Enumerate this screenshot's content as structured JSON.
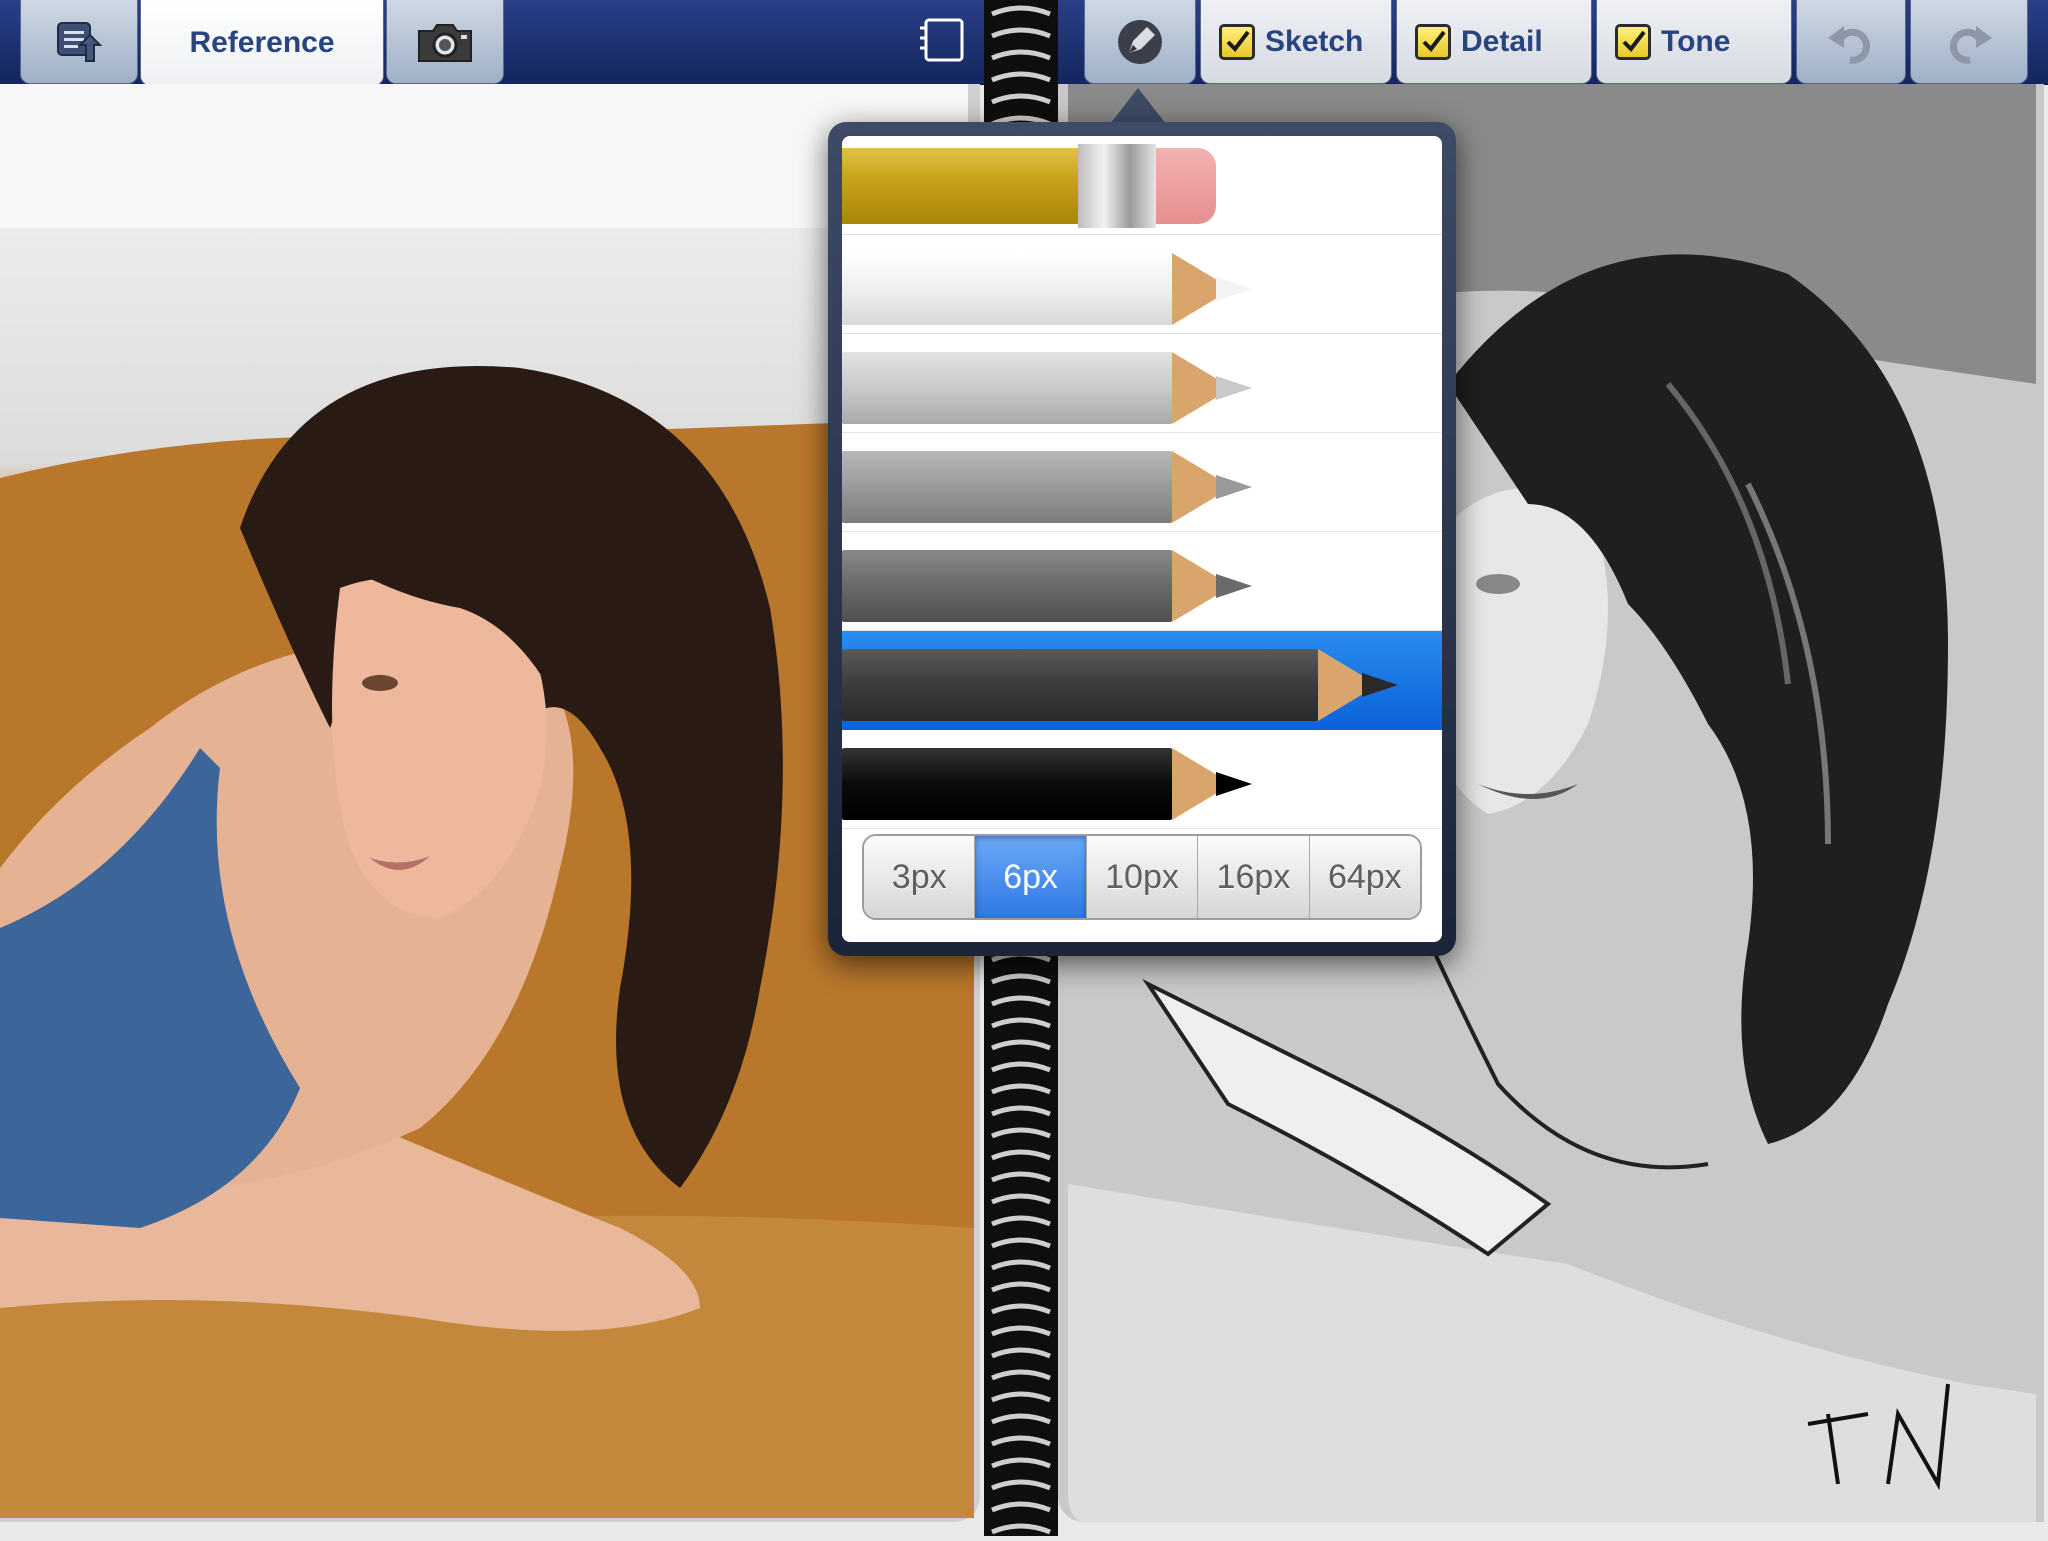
{
  "toolbar": {
    "reference_tab_label": "Reference",
    "layers": [
      {
        "label": "Sketch",
        "checked": true
      },
      {
        "label": "Detail",
        "checked": true
      },
      {
        "label": "Tone",
        "checked": true
      }
    ]
  },
  "icons": {
    "gallery": "gallery-export-icon",
    "camera": "camera-icon",
    "page": "page-toggle-icon",
    "pencil_tool": "pencil-tool-icon",
    "undo": "undo-icon",
    "redo": "redo-icon"
  },
  "pencil_picker": {
    "pencils": [
      {
        "name": "eraser",
        "color": "#c8a21a"
      },
      {
        "name": "white",
        "color": "#f2f2f2"
      },
      {
        "name": "light-gray",
        "color": "#c9c9c9"
      },
      {
        "name": "mid-gray",
        "color": "#9a9a9a"
      },
      {
        "name": "dark-gray",
        "color": "#6a6a6a"
      },
      {
        "name": "charcoal",
        "color": "#3c3c3c",
        "selected": true
      },
      {
        "name": "black",
        "color": "#0b0b0b"
      }
    ],
    "sizes": [
      "3px",
      "6px",
      "10px",
      "16px",
      "64px"
    ],
    "selected_size": "6px"
  },
  "colors": {
    "toolbar": "#1b2f6e",
    "selection": "#0a6be0"
  }
}
